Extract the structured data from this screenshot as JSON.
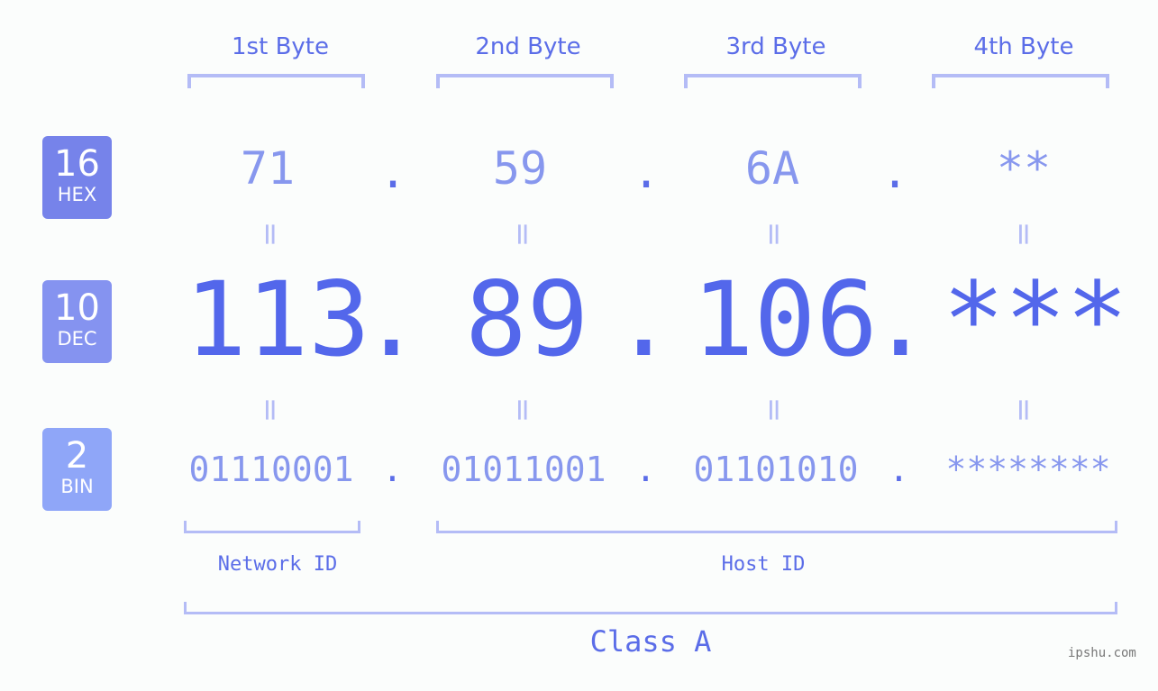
{
  "badges": [
    {
      "num": "16",
      "label": "HEX",
      "color": "#7683ea"
    },
    {
      "num": "10",
      "label": "DEC",
      "color": "#8593f0"
    },
    {
      "num": "2",
      "label": "BIN",
      "color": "#8fa6f8"
    }
  ],
  "byte_headers": [
    "1st Byte",
    "2nd Byte",
    "3rd Byte",
    "4th Byte"
  ],
  "hex": [
    "71",
    "59",
    "6A",
    "**"
  ],
  "dec": [
    "113",
    "89",
    "106",
    "***"
  ],
  "bin": [
    "01110001",
    "01011001",
    "01101010",
    "********"
  ],
  "separator": ".",
  "equals": "=",
  "network_id_label": "Network ID",
  "host_id_label": "Host ID",
  "class_label": "Class A",
  "watermark": "ipshu.com",
  "colors": {
    "accent": "#5367eb",
    "light": "#8797ee",
    "bracket": "#b4bcf6"
  }
}
